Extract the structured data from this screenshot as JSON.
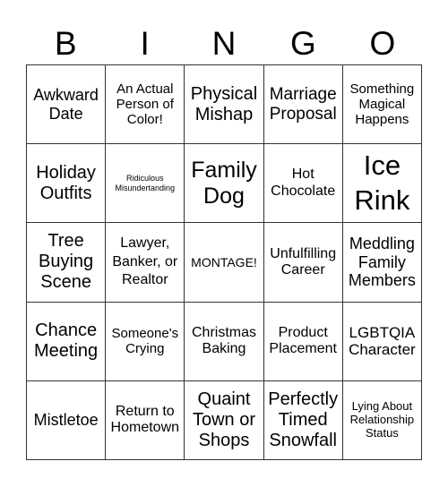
{
  "header": [
    "B",
    "I",
    "N",
    "G",
    "O"
  ],
  "cells": [
    "Awkward Date",
    "An Actual Person of Color!",
    "Physical Mishap",
    "Marriage Proposal",
    "Something Magical Happens",
    "Holiday Outfits",
    "Ridiculous Misundertanding",
    "Family Dog",
    "Hot Chocolate",
    "Ice Rink",
    "Tree Buying Scene",
    "Lawyer, Banker, or Realtor",
    "MONTAGE!",
    "Unfulfilling Career",
    "Meddling Family Members",
    "Chance Meeting",
    "Someone's Crying",
    "Christmas Baking",
    "Product Placement",
    "LGBTQIA Character",
    "Mistletoe",
    "Return to Hometown",
    "Quaint Town or Shops",
    "Perfectly Timed Snowfall",
    "Lying About Relationship Status"
  ]
}
